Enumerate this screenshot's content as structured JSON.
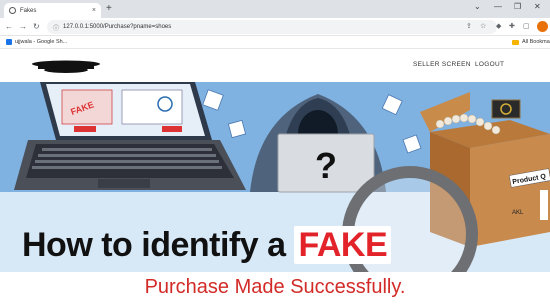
{
  "browser": {
    "tab_title": "Fakes",
    "tab_close": "×",
    "new_tab": "+",
    "url": "127.0.0.1:5000/Purchase?pname=shoes",
    "win_controls": [
      "⌄",
      "—",
      "❐",
      "✕"
    ],
    "bookmarks": [
      {
        "label": "ujjwala - Google Sh..."
      },
      {
        "label": "All Bookma"
      }
    ]
  },
  "site": {
    "nav": {
      "seller_screen": "SELLER SCREEN",
      "logout": "LOGOUT"
    },
    "hero": {
      "headline_prefix": "How to identify a ",
      "headline_highlight": "FAKE",
      "question_mark": "?",
      "box_label": "Product Q",
      "box_code": "AKL"
    },
    "message": "Purchase Made Successfully."
  },
  "colors": {
    "accent_red": "#d22b27",
    "fake_red": "#e2232a",
    "hero_sky": "#7fb1e1",
    "profile": "#e8710a"
  }
}
